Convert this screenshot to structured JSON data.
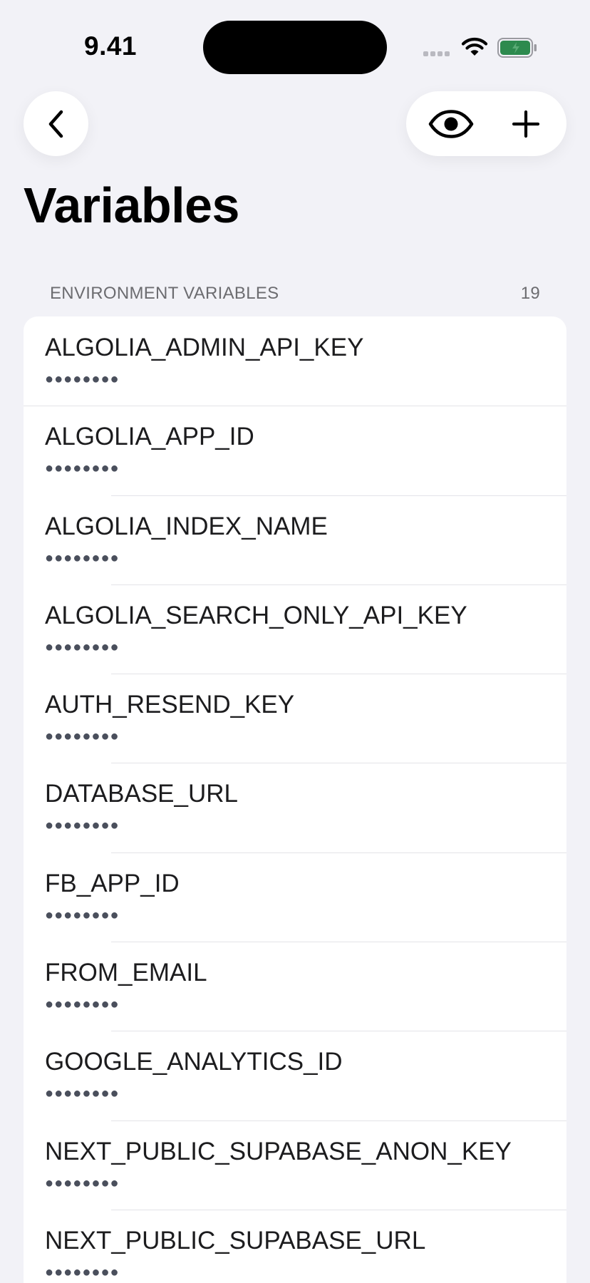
{
  "status_bar": {
    "time": "9.41"
  },
  "nav": {
    "back_icon": "chevron-left-icon",
    "visibility_icon": "eye-icon",
    "add_icon": "plus-icon"
  },
  "page": {
    "title": "Variables"
  },
  "section": {
    "header": "ENVIRONMENT VARIABLES",
    "count": "19"
  },
  "variables": [
    {
      "name": "ALGOLIA_ADMIN_API_KEY",
      "value": "●●●●●●●●"
    },
    {
      "name": "ALGOLIA_APP_ID",
      "value": "●●●●●●●●"
    },
    {
      "name": "ALGOLIA_INDEX_NAME",
      "value": "●●●●●●●●"
    },
    {
      "name": "ALGOLIA_SEARCH_ONLY_API_KEY",
      "value": "●●●●●●●●"
    },
    {
      "name": "AUTH_RESEND_KEY",
      "value": "●●●●●●●●"
    },
    {
      "name": "DATABASE_URL",
      "value": "●●●●●●●●"
    },
    {
      "name": "FB_APP_ID",
      "value": "●●●●●●●●"
    },
    {
      "name": "FROM_EMAIL",
      "value": "●●●●●●●●"
    },
    {
      "name": "GOOGLE_ANALYTICS_ID",
      "value": "●●●●●●●●"
    },
    {
      "name": "NEXT_PUBLIC_SUPABASE_ANON_KEY",
      "value": "●●●●●●●●"
    },
    {
      "name": "NEXT_PUBLIC_SUPABASE_URL",
      "value": "●●●●●●●●"
    }
  ],
  "colors": {
    "background": "#f2f2f7",
    "card": "#ffffff",
    "battery_fill": "#2d8a4e"
  }
}
